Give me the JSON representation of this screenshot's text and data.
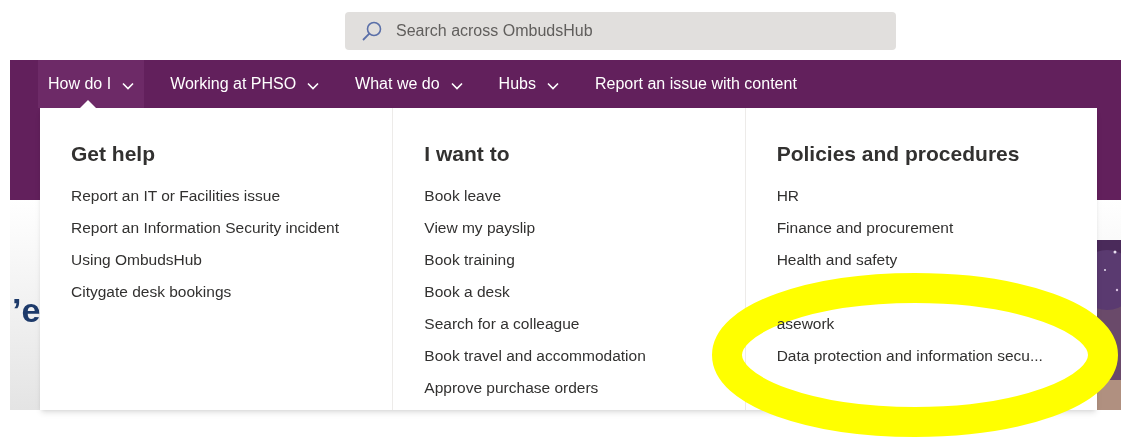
{
  "search": {
    "placeholder": "Search across OmbudsHub"
  },
  "nav": [
    {
      "label": "How do I",
      "kind": "dropdown",
      "selected": true
    },
    {
      "label": "Working at PHSO",
      "kind": "dropdown",
      "selected": false
    },
    {
      "label": "What we do",
      "kind": "dropdown",
      "selected": false
    },
    {
      "label": "Hubs",
      "kind": "dropdown",
      "selected": false
    },
    {
      "label": "Report an issue with content",
      "kind": "link",
      "selected": false
    }
  ],
  "hero_text_fragment": "’e",
  "menu_columns": [
    {
      "heading": "Get help",
      "items": [
        "Report an IT or Facilities issue",
        "Report an Information Security incident",
        "Using OmbudsHub",
        "Citygate desk bookings"
      ]
    },
    {
      "heading": "I want to",
      "items": [
        "Book leave",
        "View my payslip",
        "Book training",
        "Book a desk",
        "Search for a colleague",
        "Book travel and accommodation",
        "Approve purchase orders"
      ]
    },
    {
      "heading": "Policies and procedures",
      "items": [
        "HR",
        "Finance and procurement",
        "Health and safety",
        "asework",
        "Data protection and information secu..."
      ]
    }
  ]
}
